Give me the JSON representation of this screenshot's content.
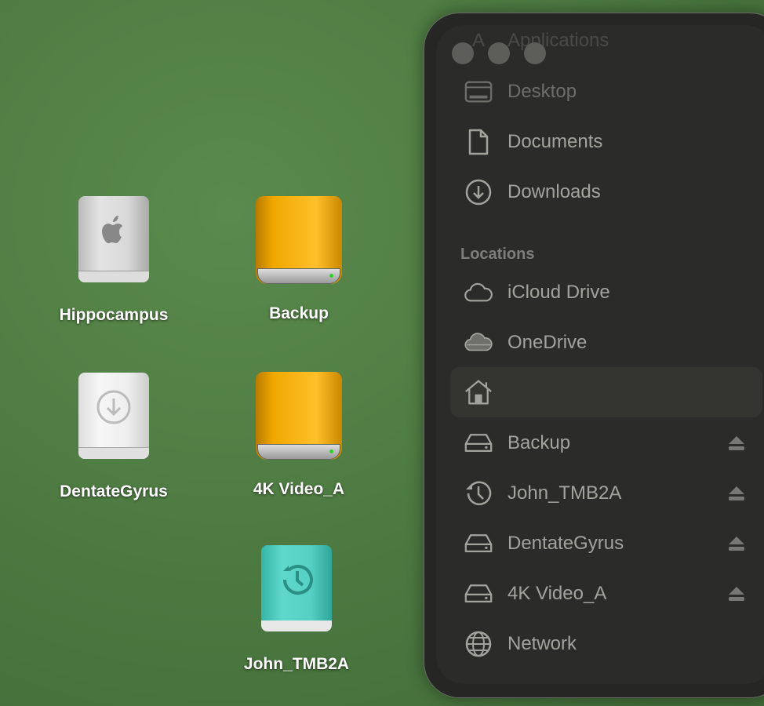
{
  "desktop": {
    "icons": [
      {
        "label": "Hippocampus",
        "type": "internal-drive"
      },
      {
        "label": "Backup",
        "type": "external-drive"
      },
      {
        "label": "DentateGyrus",
        "type": "download-drive"
      },
      {
        "label": "4K Video_A",
        "type": "external-drive"
      },
      {
        "label": "John_TMB2A",
        "type": "time-machine-drive"
      }
    ]
  },
  "sidebar": {
    "favorites": [
      {
        "label": "Applications",
        "icon": "applications-icon"
      },
      {
        "label": "Desktop",
        "icon": "desktop-icon"
      },
      {
        "label": "Documents",
        "icon": "document-icon"
      },
      {
        "label": "Downloads",
        "icon": "download-icon"
      }
    ],
    "locations_header": "Locations",
    "locations": [
      {
        "label": "iCloud Drive",
        "icon": "cloud-icon"
      },
      {
        "label": "OneDrive",
        "icon": "cloud-filled-icon"
      },
      {
        "label": "",
        "icon": "home-icon",
        "selected": true
      },
      {
        "label": "Backup",
        "icon": "drive-icon",
        "eject": true
      },
      {
        "label": "John_TMB2A",
        "icon": "time-machine-icon",
        "eject": true
      },
      {
        "label": "DentateGyrus",
        "icon": "drive-icon",
        "eject": true
      },
      {
        "label": "4K Video_A",
        "icon": "drive-icon",
        "eject": true
      },
      {
        "label": "Network",
        "icon": "globe-icon"
      }
    ]
  }
}
